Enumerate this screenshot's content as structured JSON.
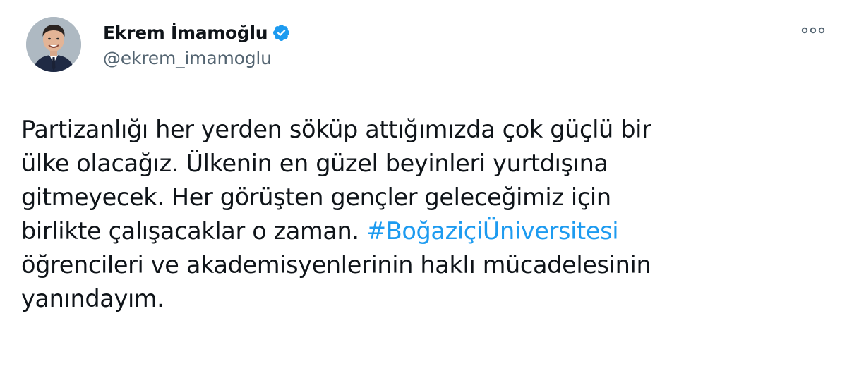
{
  "author": {
    "display_name": "Ekrem İmamoğlu",
    "handle": "@ekrem_imamoglu",
    "verified": true
  },
  "icons": {
    "verified": "verified-badge-icon",
    "more": "more-options-icon"
  },
  "colors": {
    "text": "#0f1419",
    "secondary": "#536471",
    "link": "#1d9bf0",
    "verified": "#1d9bf0"
  },
  "tweet": {
    "lines": [
      "Partizanlığı her yerden söküp attığımızda çok güçlü bir",
      "ülke olacağız. Ülkenin en güzel beyinleri yurtdışına",
      "gitmeyecek. Her görüşten gençler geleceğimiz için",
      "birlikte çalışacaklar o zaman. ",
      "öğrencileri ve akademisyenlerinin haklı mücadelesinin",
      "yanındayım."
    ],
    "hashtag": "#BoğaziçiÜniversitesi"
  }
}
